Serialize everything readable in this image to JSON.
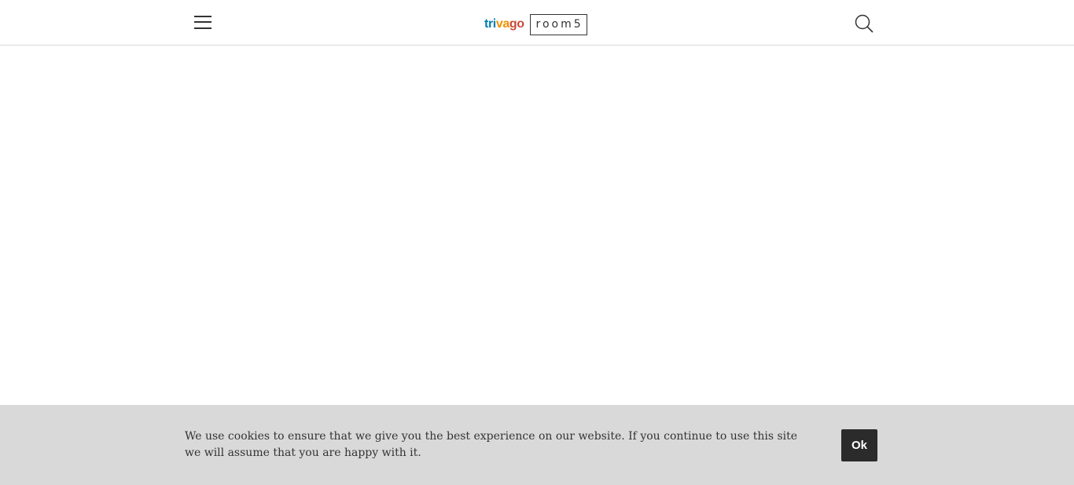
{
  "header": {
    "menu_icon": "hamburger-menu-icon",
    "logo": {
      "brand_text": "trivago",
      "brand_letters": [
        {
          "char": "t",
          "color": "#007faf"
        },
        {
          "char": "r",
          "color": "#007faf"
        },
        {
          "char": "i",
          "color": "#007faf"
        },
        {
          "char": "v",
          "color": "#f48f00"
        },
        {
          "char": "a",
          "color": "#f48f00"
        },
        {
          "char": "g",
          "color": "#c94a38"
        },
        {
          "char": "o",
          "color": "#c94a38"
        }
      ],
      "product_text": "room5"
    },
    "search_icon": "search-icon"
  },
  "cookie_notice": {
    "message": "We use cookies to ensure that we give you the best experience on our website. If you continue to use this site we will assume that you are happy with it.",
    "ok_label": "Ok"
  },
  "colors": {
    "header_bg": "#ffffff",
    "cookie_bar_bg": "#d9d9d9",
    "ok_button_bg": "#2b2b2b",
    "text": "#333333"
  }
}
